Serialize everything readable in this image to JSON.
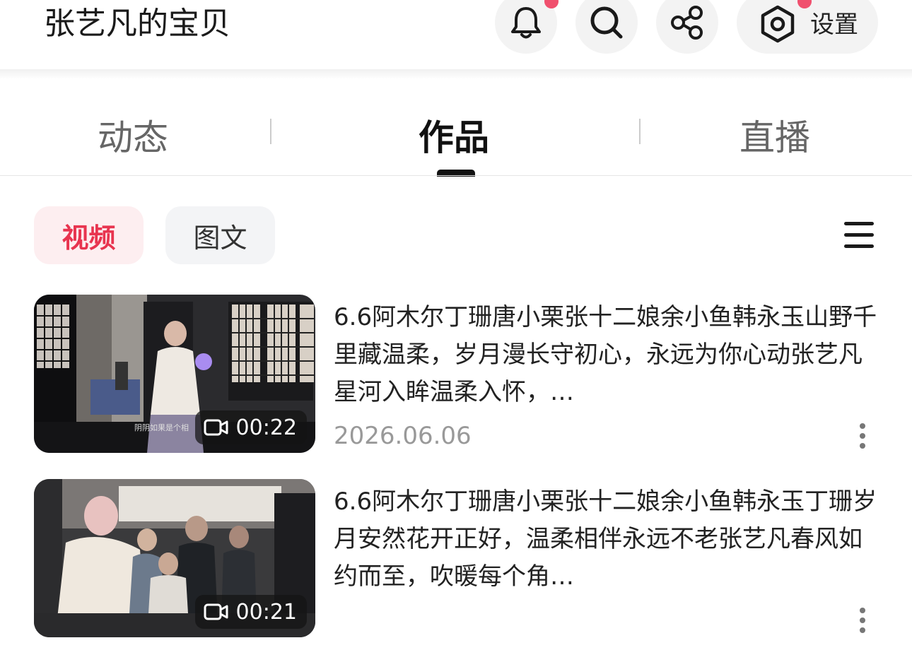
{
  "header": {
    "title": "张艺凡的宝贝",
    "settings_label": "设置",
    "icons": [
      "bell-icon",
      "search-icon",
      "share-icon",
      "settings-icon"
    ],
    "accent_color": "#f0506e"
  },
  "tabs": [
    {
      "label": "动态",
      "active": false
    },
    {
      "label": "作品",
      "active": true
    },
    {
      "label": "直播",
      "active": false
    }
  ],
  "filters": [
    {
      "label": "视频",
      "active": true
    },
    {
      "label": "图文",
      "active": false
    }
  ],
  "videos": [
    {
      "title": "6.6阿木尔丁珊唐小栗张十二娘余小鱼韩永玉山野千里藏温柔，岁月漫长守初心，永远为你心动张艺凡星河入眸温柔入怀，…",
      "duration": "00:22",
      "date": "2026.06.06",
      "caption_overlay": "阴阴如果是个相"
    },
    {
      "title": "6.6阿木尔丁珊唐小栗张十二娘余小鱼韩永玉丁珊岁月安然花开正好，温柔相伴永远不老张艺凡春风如约而至，吹暖每个角…",
      "duration": "00:21",
      "date": ""
    }
  ]
}
